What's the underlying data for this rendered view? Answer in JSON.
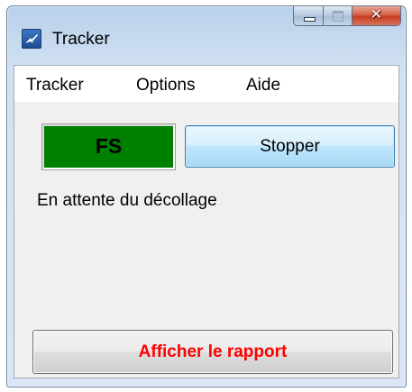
{
  "window": {
    "title": "Tracker",
    "icon": "plane-takeoff-icon",
    "caption_buttons": [
      "minimize-icon",
      "maximize-icon",
      "close-icon"
    ]
  },
  "menu": {
    "items": [
      {
        "label": "Tracker"
      },
      {
        "label": "Options"
      },
      {
        "label": "Aide"
      }
    ]
  },
  "main": {
    "indicator": {
      "label": "FS",
      "color": "#008000"
    },
    "stop_button_label": "Stopper",
    "status_text": "En attente du décollage",
    "report_button": {
      "label": "Afficher le rapport",
      "color": "#ff0000"
    }
  }
}
